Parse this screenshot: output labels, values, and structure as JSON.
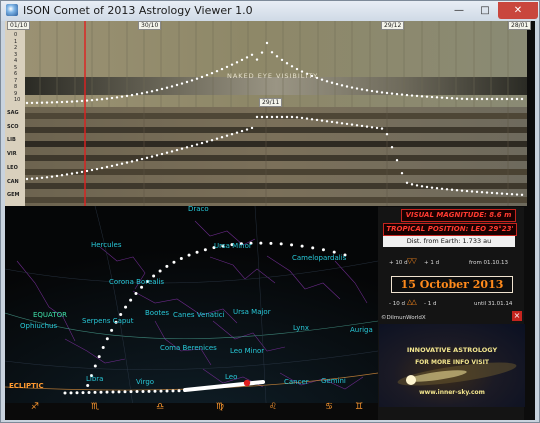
{
  "window": {
    "title": "ISON Comet of 2013 Astrology Viewer 1.0",
    "min_glyph": "—",
    "max_glyph": "□",
    "close_glyph": "✕"
  },
  "timeline": {
    "date_labels": [
      "01/10",
      "30/10",
      "29/11",
      "29/12",
      "28/01"
    ],
    "peak_label": "29/11",
    "visibility_label": "NAKED EYE VISIBILITY",
    "magnitude_scale": [
      "-2",
      "-1",
      "0",
      "1",
      "2",
      "3",
      "4",
      "5",
      "6",
      "7",
      "8",
      "9",
      "10"
    ],
    "sign_labels": [
      "SAG",
      "SCO",
      "LIB",
      "VIR",
      "LEO",
      "CAN",
      "GEM"
    ]
  },
  "starmap": {
    "constellations": [
      "Draco",
      "Hercules",
      "Ursa Minor",
      "Camelopardalis",
      "Corona Borealis",
      "Serpens Caput",
      "Bootes",
      "Canes Venatici",
      "Ursa Major",
      "Lynx",
      "Auriga",
      "Ophiuchus",
      "Coma Berenices",
      "Leo Minor",
      "Libra",
      "Virgo",
      "Leo",
      "Cancer",
      "Gemini"
    ],
    "equator_label": "EQUATOR",
    "ecliptic_label": "ECLIPTIC",
    "zodiac_glyphs": [
      "♐",
      "♏",
      "♎",
      "♍",
      "♌",
      "♋",
      "♊"
    ]
  },
  "info_panel": {
    "visual_magnitude": "VISUAL MAGNITUDE: 8.6 m",
    "tropical_position": "TROPICAL POSITION: LEO 29°23'",
    "distance": "Dist. from Earth:  1.733 au",
    "step_up_minus": "+ 10 d",
    "step_up_plus": "+ 1 d",
    "from_label": "from 01.10.13",
    "current_date": "15 October 2013",
    "step_down_minus": "- 10 d",
    "step_down_plus": "- 1 d",
    "until_label": "until 31.01.14",
    "creator": "©DilmunWorldX",
    "close_glyph": "×"
  },
  "banner": {
    "line1": "INNOVATIVE ASTROLOGY",
    "line2": "FOR MORE INFO VISIT",
    "line3": "www.inner-sky.com"
  },
  "colors": {
    "titlebar": "#cfdae6",
    "timeline_bg": "#8a8266",
    "orange": "#ff8a1c",
    "red": "#ff3a30",
    "cursor": "#e02020"
  }
}
